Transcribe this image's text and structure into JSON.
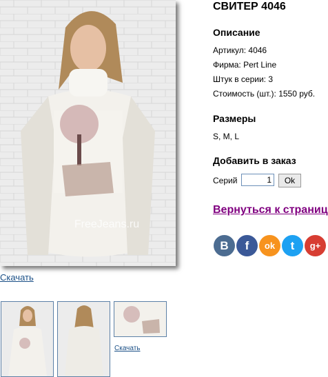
{
  "product": {
    "title": "СВИТЕР 4046",
    "photo_watermark": "FreeJeans.ru",
    "download_label": "Скачать"
  },
  "description": {
    "heading": "Описание",
    "article": "Артикул: 4046",
    "brand": "Фирма: Pert Line",
    "series": "Штук в серии: 3",
    "price": "Стоимость (шт.): 1550 руб."
  },
  "sizes": {
    "heading": "Размеры",
    "values": "S, M, L"
  },
  "order": {
    "heading": "Добавить в заказ",
    "series_label": "Серий",
    "quantity": "1",
    "ok_label": "Ok"
  },
  "back_link": "Вернуться к страниц",
  "social": {
    "items": [
      {
        "name": "vk-icon",
        "glyph": "B",
        "color": "#4c6c91"
      },
      {
        "name": "facebook-icon",
        "glyph": "f",
        "color": "#3b5998"
      },
      {
        "name": "odnoklassniki-icon",
        "glyph": "ok",
        "color": "#f7931e"
      },
      {
        "name": "twitter-icon",
        "glyph": "t",
        "color": "#1da1f2"
      },
      {
        "name": "googleplus-icon",
        "glyph": "g+",
        "color": "#d73d32"
      }
    ]
  },
  "thumbnails": {
    "download_label": "Скачать",
    "items": [
      "front-view",
      "back-view",
      "print-closeup"
    ]
  }
}
